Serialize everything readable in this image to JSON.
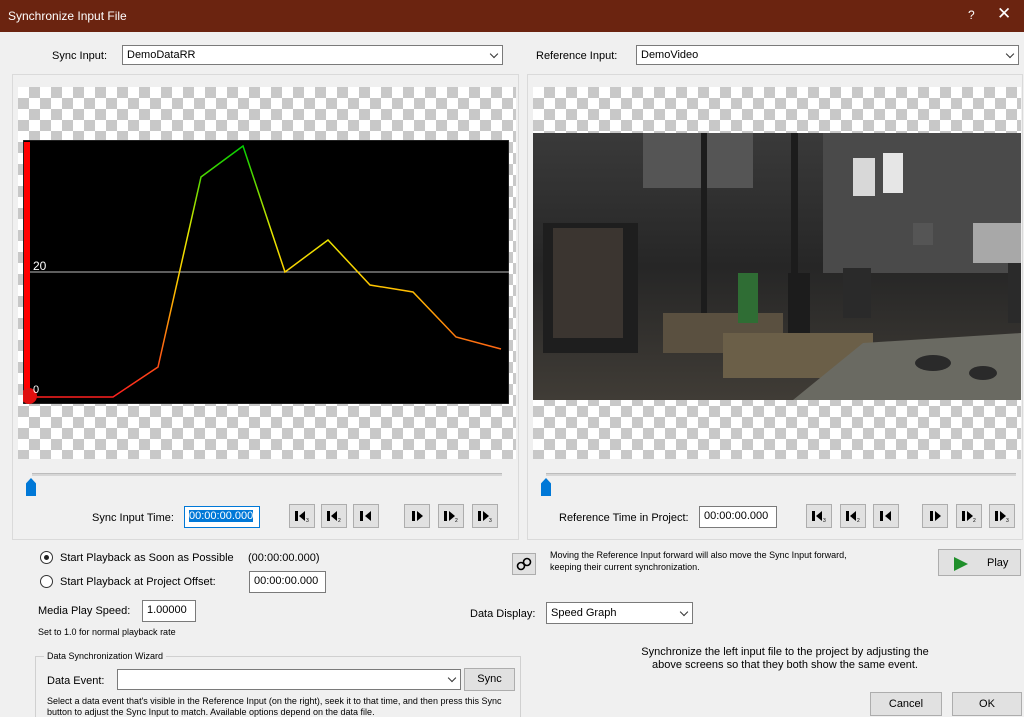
{
  "window": {
    "title": "Synchronize Input File",
    "help": "?",
    "close": "✕"
  },
  "sync_input": {
    "label": "Sync Input:",
    "value": "DemoDataRR"
  },
  "reference_input": {
    "label": "Reference Input:",
    "value": "DemoVideo"
  },
  "graph": {
    "y_labels": [
      "20",
      "0"
    ]
  },
  "left_controls": {
    "time_label": "Sync Input Time:",
    "time_value": "00:00:00.000"
  },
  "right_controls": {
    "time_label": "Reference Time in Project:",
    "time_value": "00:00:00.000"
  },
  "nav_buttons": [
    "step-back-3",
    "step-back-2",
    "step-back-1",
    "step-forward-1",
    "step-forward-2",
    "step-forward-3"
  ],
  "playback": {
    "option1_label": "Start Playback as Soon as Possible",
    "option1_time": "(00:00:00.000)",
    "option2_label": "Start Playback at Project Offset:",
    "option2_value": "00:00:00.000",
    "selected": "option1"
  },
  "link_hint": "Moving the Reference Input forward will also move the Sync Input forward, keeping their current synchronization.",
  "play_label": "Play",
  "media_speed": {
    "label": "Media Play Speed:",
    "value": "1.00000",
    "hint": "Set to 1.0 for normal playback rate"
  },
  "data_display": {
    "label": "Data Display:",
    "value": "Speed Graph"
  },
  "sync_info": "Synchronize the left input file to the project by adjusting the above screens so that they both show the same event.",
  "wizard": {
    "title": "Data Synchronization Wizard",
    "event_label": "Data Event:",
    "event_value": "",
    "sync_label": "Sync",
    "description": "Select a data event that's visible in the Reference Input (on the right), seek it to that time, and then press this Sync button to adjust the Sync Input to match. Available options depend on the data file."
  },
  "cancel_label": "Cancel",
  "ok_label": "OK",
  "colors": {
    "title_bar": "#6b2410",
    "accent": "#0078d7",
    "graph_bg": "#000000",
    "play_green": "#1f8f2a"
  }
}
